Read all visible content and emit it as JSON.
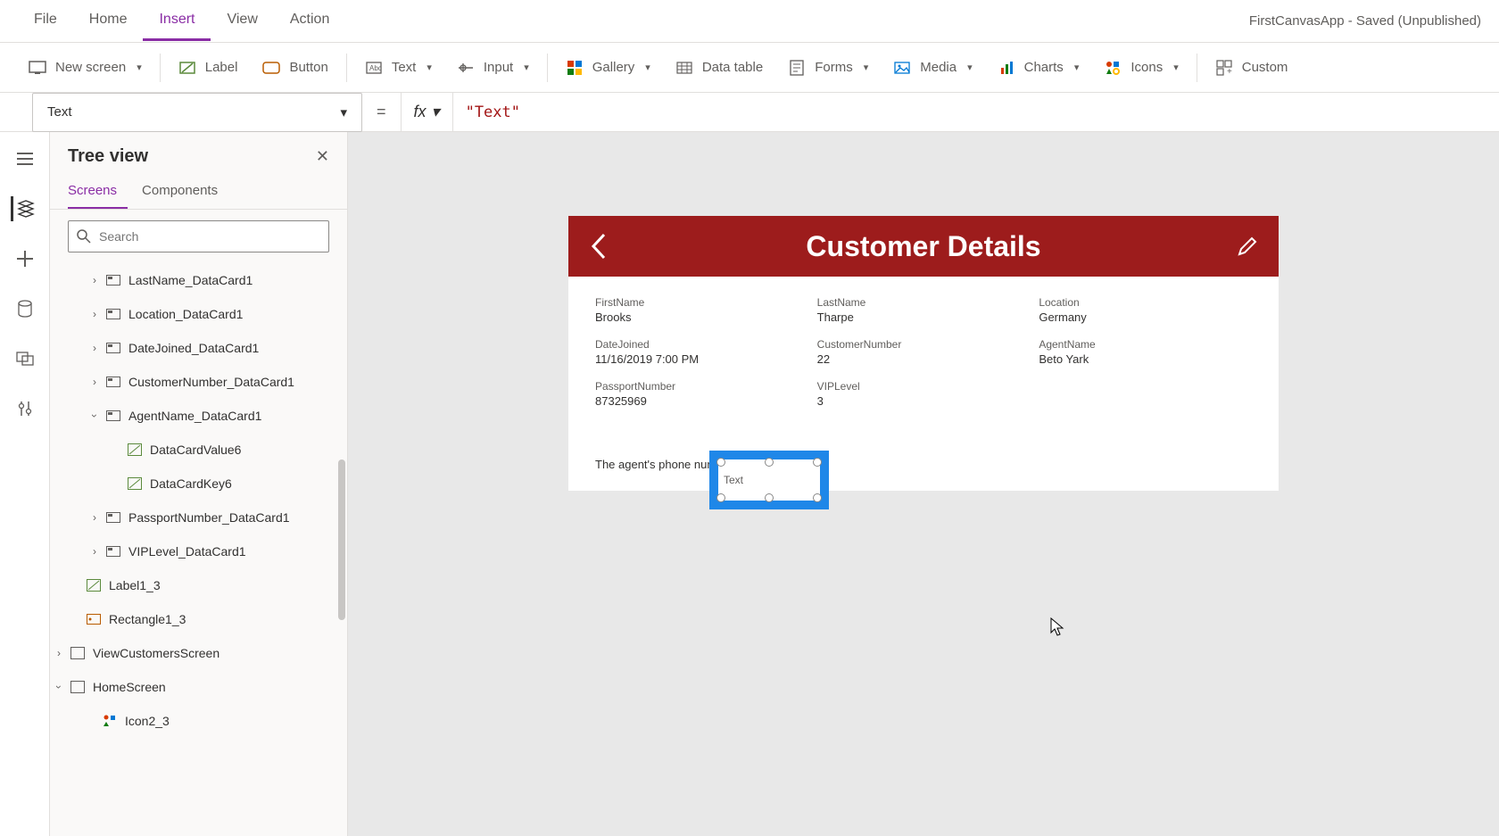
{
  "app_status": "FirstCanvasApp - Saved (Unpublished)",
  "menubar": {
    "file": "File",
    "home": "Home",
    "insert": "Insert",
    "view": "View",
    "action": "Action"
  },
  "ribbon": {
    "new_screen": "New screen",
    "label": "Label",
    "button": "Button",
    "text": "Text",
    "input": "Input",
    "gallery": "Gallery",
    "data_table": "Data table",
    "forms": "Forms",
    "media": "Media",
    "charts": "Charts",
    "icons": "Icons",
    "custom": "Custom"
  },
  "formula": {
    "property": "Text",
    "value": "\"Text\""
  },
  "tree": {
    "title": "Tree view",
    "tabs": {
      "screens": "Screens",
      "components": "Components"
    },
    "search_placeholder": "Search",
    "nodes": {
      "lastname": "LastName_DataCard1",
      "location": "Location_DataCard1",
      "datejoined": "DateJoined_DataCard1",
      "customernumber": "CustomerNumber_DataCard1",
      "agentname": "AgentName_DataCard1",
      "datacardvalue6": "DataCardValue6",
      "datacardkey6": "DataCardKey6",
      "passportnumber": "PassportNumber_DataCard1",
      "viplevel": "VIPLevel_DataCard1",
      "label1_3": "Label1_3",
      "rectangle1_3": "Rectangle1_3",
      "viewcustomers": "ViewCustomersScreen",
      "homescreen": "HomeScreen",
      "icon2_3": "Icon2_3"
    }
  },
  "screen": {
    "title": "Customer Details",
    "firstname_l": "FirstName",
    "firstname_v": "Brooks",
    "lastname_l": "LastName",
    "lastname_v": "Tharpe",
    "location_l": "Location",
    "location_v": "Germany",
    "datejoined_l": "DateJoined",
    "datejoined_v": "11/16/2019 7:00 PM",
    "custnum_l": "CustomerNumber",
    "custnum_v": "22",
    "agentname_l": "AgentName",
    "agentname_v": "Beto Yark",
    "passport_l": "PassportNumber",
    "passport_v": "87325969",
    "vip_l": "VIPLevel",
    "vip_v": "3",
    "agent_phone_text": "The agent's phone number is:",
    "selected_text": "Text"
  }
}
